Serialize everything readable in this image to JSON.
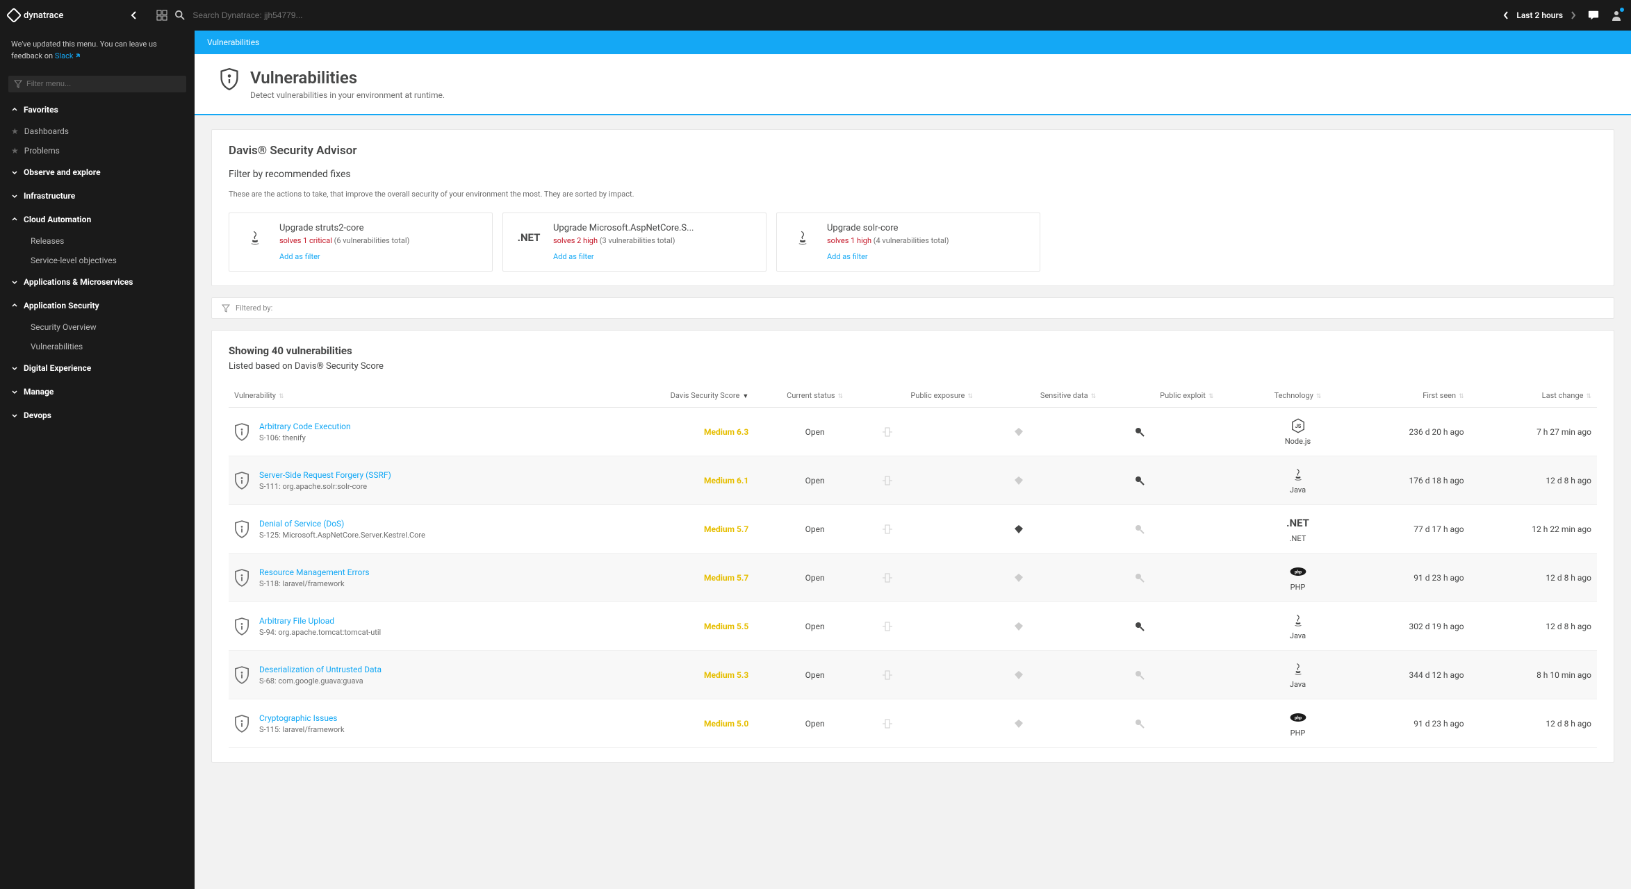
{
  "topbar": {
    "brand": "dynatrace",
    "search_placeholder": "Search Dynatrace: jjh54779...",
    "timeframe": "Last 2 hours"
  },
  "sidebar": {
    "notice_prefix": "We've updated this menu. You can leave us feedback on ",
    "notice_link": "Slack",
    "filter_placeholder": "Filter menu...",
    "sections": [
      {
        "label": "Favorites",
        "expanded": true,
        "items": [
          {
            "label": "Dashboards",
            "starred": true
          },
          {
            "label": "Problems",
            "starred": true
          }
        ]
      },
      {
        "label": "Observe and explore",
        "expanded": false,
        "items": []
      },
      {
        "label": "Infrastructure",
        "expanded": false,
        "items": []
      },
      {
        "label": "Cloud Automation",
        "expanded": true,
        "items": [
          {
            "label": "Releases"
          },
          {
            "label": "Service-level objectives"
          }
        ]
      },
      {
        "label": "Applications & Microservices",
        "expanded": false,
        "items": []
      },
      {
        "label": "Application Security",
        "expanded": true,
        "items": [
          {
            "label": "Security Overview"
          },
          {
            "label": "Vulnerabilities"
          }
        ]
      },
      {
        "label": "Digital Experience",
        "expanded": false,
        "items": []
      },
      {
        "label": "Manage",
        "expanded": false,
        "items": []
      },
      {
        "label": "Devops",
        "expanded": false,
        "items": []
      }
    ]
  },
  "breadcrumb": "Vulnerabilities",
  "page": {
    "title": "Vulnerabilities",
    "subtitle": "Detect vulnerabilities in your environment at runtime."
  },
  "advisor": {
    "title": "Davis® Security Advisor",
    "subtitle": "Filter by recommended fixes",
    "description": "These are the actions to take, that improve the overall security of your environment the most. They are sorted by impact.",
    "fixes": [
      {
        "icon": "java",
        "title": "Upgrade struts2-core",
        "severity": "solves 1 critical",
        "count": "(6 vulnerabilities total)",
        "link": "Add as filter"
      },
      {
        "icon": "dotnet",
        "title": "Upgrade Microsoft.AspNetCore.S...",
        "severity": "solves 2 high",
        "count": "(3 vulnerabilities total)",
        "link": "Add as filter"
      },
      {
        "icon": "java",
        "title": "Upgrade solr-core",
        "severity": "solves 1 high",
        "count": "(4 vulnerabilities total)",
        "link": "Add as filter"
      }
    ]
  },
  "filter_label": "Filtered by:",
  "results": {
    "heading": "Showing 40 vulnerabilities",
    "subheading": "Listed based on Davis® Security Score",
    "columns": {
      "vulnerability": "Vulnerability",
      "score": "Davis Security Score",
      "status": "Current status",
      "exposure": "Public exposure",
      "sensitive": "Sensitive data",
      "exploit": "Public exploit",
      "technology": "Technology",
      "first_seen": "First seen",
      "last_change": "Last change"
    },
    "rows": [
      {
        "name": "Arbitrary Code Execution",
        "id": "S-106: thenify",
        "score": "Medium 6.3",
        "status": "Open",
        "exposure": false,
        "sensitive": false,
        "exploit": true,
        "tech": "Node.js",
        "tech_icon": "nodejs",
        "first_seen": "236 d 20 h ago",
        "last_change": "7 h 27 min ago"
      },
      {
        "name": "Server-Side Request Forgery (SSRF)",
        "id": "S-111: org.apache.solr:solr-core",
        "score": "Medium 6.1",
        "status": "Open",
        "exposure": false,
        "sensitive": false,
        "exploit": true,
        "tech": "Java",
        "tech_icon": "java",
        "first_seen": "176 d 18 h ago",
        "last_change": "12 d 8 h ago"
      },
      {
        "name": "Denial of Service (DoS)",
        "id": "S-125: Microsoft.AspNetCore.Server.Kestrel.Core",
        "score": "Medium 5.7",
        "status": "Open",
        "exposure": false,
        "sensitive": true,
        "exploit": false,
        "tech": ".NET",
        "tech_icon": "dotnet",
        "first_seen": "77 d 17 h ago",
        "last_change": "12 h 22 min ago"
      },
      {
        "name": "Resource Management Errors",
        "id": "S-118: laravel/framework",
        "score": "Medium 5.7",
        "status": "Open",
        "exposure": false,
        "sensitive": false,
        "exploit": false,
        "tech": "PHP",
        "tech_icon": "php",
        "first_seen": "91 d 23 h ago",
        "last_change": "12 d 8 h ago"
      },
      {
        "name": "Arbitrary File Upload",
        "id": "S-94: org.apache.tomcat:tomcat-util",
        "score": "Medium 5.5",
        "status": "Open",
        "exposure": false,
        "sensitive": false,
        "exploit": true,
        "tech": "Java",
        "tech_icon": "java",
        "first_seen": "302 d 19 h ago",
        "last_change": "12 d 8 h ago"
      },
      {
        "name": "Deserialization of Untrusted Data",
        "id": "S-68: com.google.guava:guava",
        "score": "Medium 5.3",
        "status": "Open",
        "exposure": false,
        "sensitive": false,
        "exploit": false,
        "tech": "Java",
        "tech_icon": "java",
        "first_seen": "344 d 12 h ago",
        "last_change": "8 h 10 min ago"
      },
      {
        "name": "Cryptographic Issues",
        "id": "S-115: laravel/framework",
        "score": "Medium 5.0",
        "status": "Open",
        "exposure": false,
        "sensitive": false,
        "exploit": false,
        "tech": "PHP",
        "tech_icon": "php",
        "first_seen": "91 d 23 h ago",
        "last_change": "12 d 8 h ago"
      }
    ]
  }
}
